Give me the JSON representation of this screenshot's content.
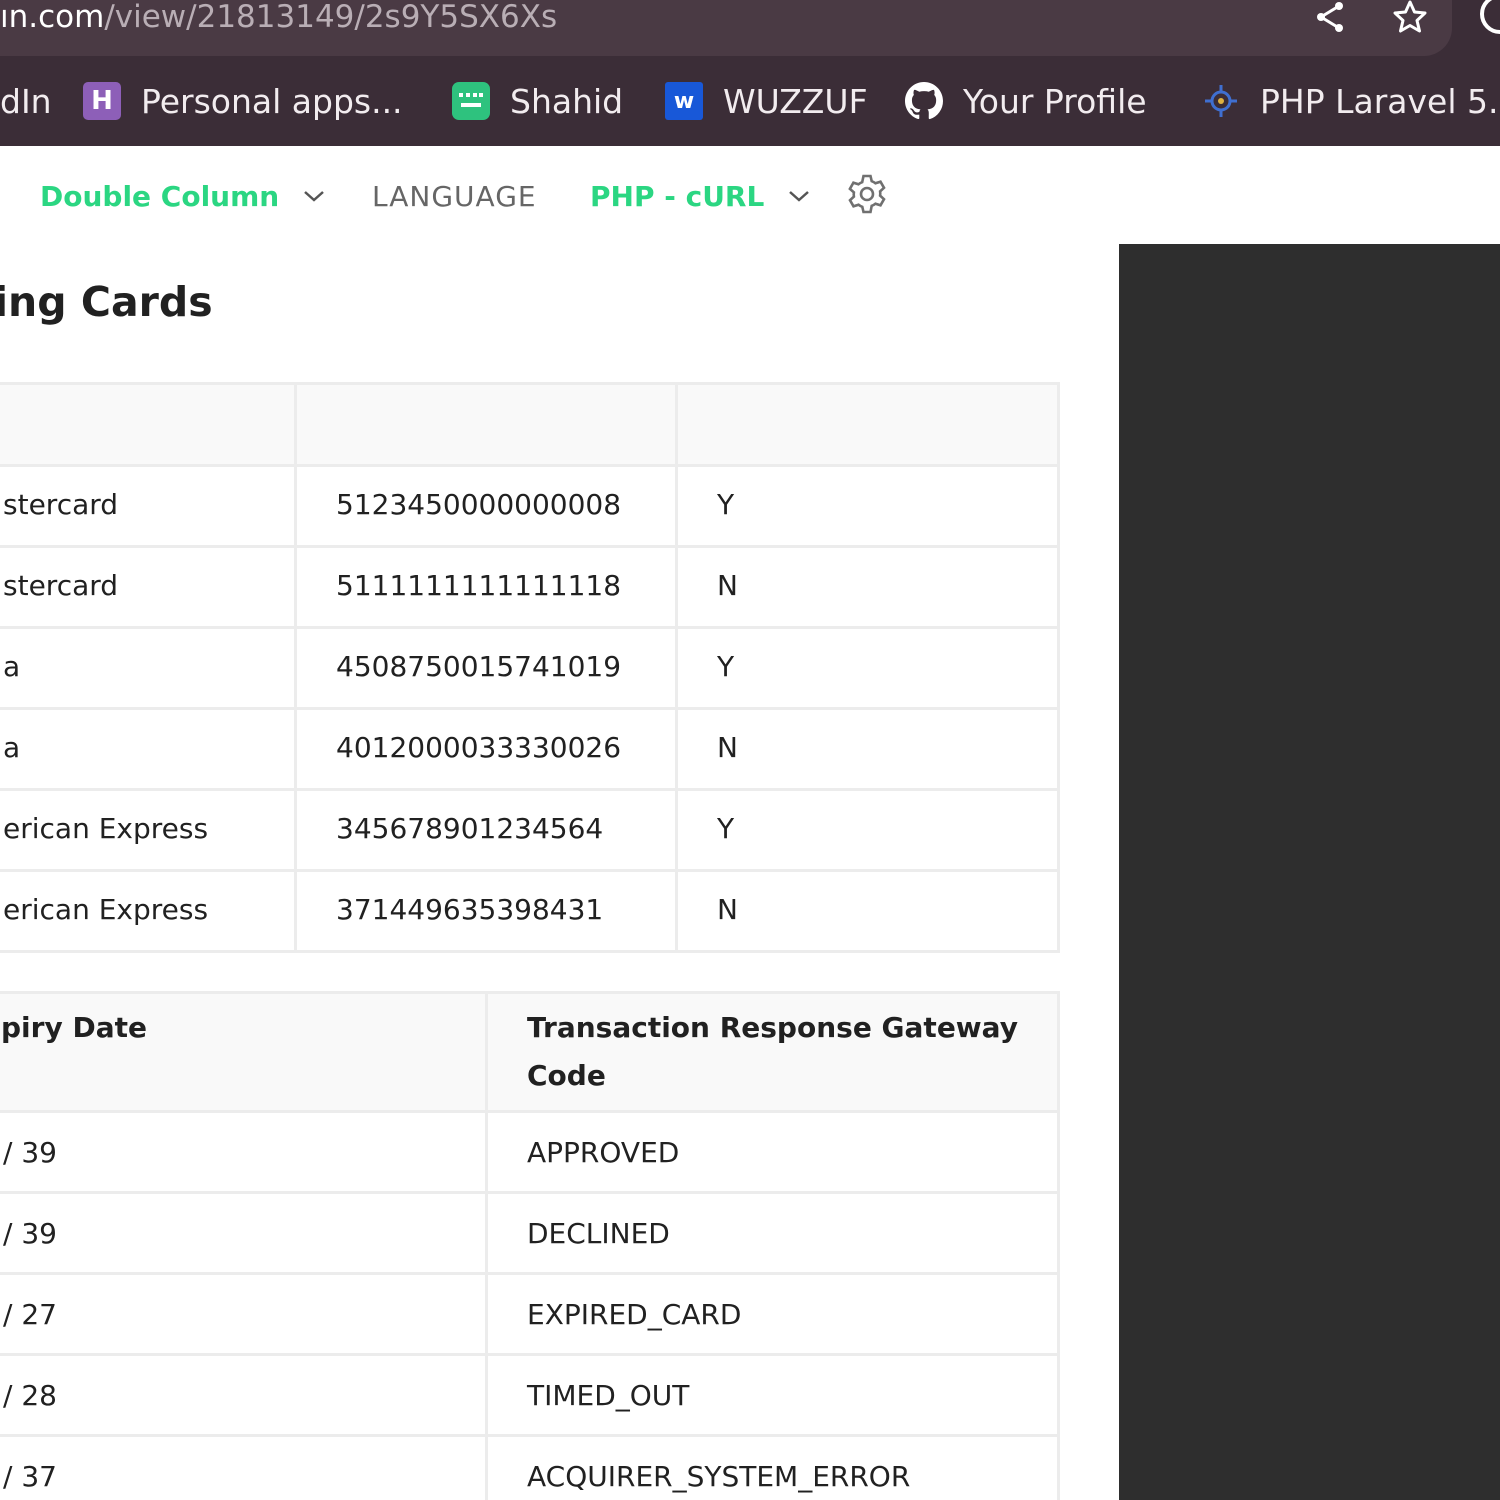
{
  "browser": {
    "url_domain": "ın.com",
    "url_path": "/view/21813149/2s9Y5SX6Xs",
    "bookmarks": [
      {
        "label": "dIn",
        "icon": "linkedin-icon"
      },
      {
        "label": "Personal apps...",
        "icon": "heroku-icon"
      },
      {
        "label": "Shahid",
        "icon": "shahid-icon"
      },
      {
        "label": "WUZZUF",
        "icon": "wuzzuf-icon"
      },
      {
        "label": "Your Profile",
        "icon": "github-icon"
      },
      {
        "label": "PHP Laravel 5...",
        "icon": "laravel-icon"
      }
    ]
  },
  "toolbar": {
    "layout_label": "Double Column",
    "language_label": "LANGUAGE",
    "language_value": "PHP - cURL"
  },
  "heading": "ing Cards",
  "cards_table": {
    "rows": [
      {
        "brand": "stercard",
        "number": "5123450000000008",
        "flag": "Y"
      },
      {
        "brand": "stercard",
        "number": "5111111111111118",
        "flag": "N"
      },
      {
        "brand": "a",
        "number": "4508750015741019",
        "flag": "Y"
      },
      {
        "brand": "a",
        "number": "4012000033330026",
        "flag": "N"
      },
      {
        "brand": "erican Express",
        "number": "345678901234564",
        "flag": "Y"
      },
      {
        "brand": "erican Express",
        "number": "371449635398431",
        "flag": "N"
      }
    ]
  },
  "gateway_table": {
    "headers": [
      "piry Date",
      "Transaction Response Gateway Code"
    ],
    "rows": [
      {
        "expiry": "/ 39",
        "code": "APPROVED"
      },
      {
        "expiry": "/ 39",
        "code": "DECLINED"
      },
      {
        "expiry": "/ 27",
        "code": "EXPIRED_CARD"
      },
      {
        "expiry": "/ 28",
        "code": "TIMED_OUT"
      },
      {
        "expiry": "/ 37",
        "code": "ACQUIRER_SYSTEM_ERROR"
      }
    ]
  },
  "colors": {
    "accent_green": "#2bd682",
    "browser_frame": "#3b2d37",
    "code_panel": "#2e2e2e"
  }
}
